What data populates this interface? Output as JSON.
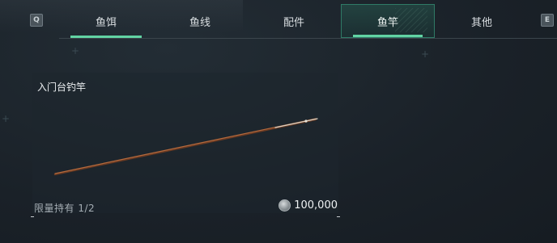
{
  "key_hints": {
    "prev": "Q",
    "next": "E"
  },
  "tabs": [
    {
      "label": "鱼饵",
      "state": "underlined"
    },
    {
      "label": "鱼线",
      "state": "normal"
    },
    {
      "label": "配件",
      "state": "normal"
    },
    {
      "label": "鱼竿",
      "state": "active"
    },
    {
      "label": "其他",
      "state": "normal"
    }
  ],
  "item_card": {
    "title": "入门台钓竿",
    "limit_text": "限量持有 1/2",
    "price": "100,000",
    "currency_icon": "silver-coin-icon"
  },
  "colors": {
    "accent": "#62d3a3",
    "background": "#1b232a"
  }
}
